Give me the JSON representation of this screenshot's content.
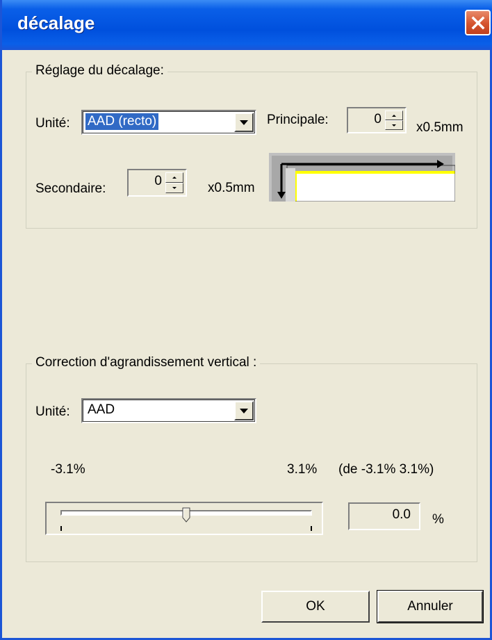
{
  "window": {
    "title": "décalage"
  },
  "offset_group": {
    "label": "Réglage du décalage:",
    "unit_label": "Unité:",
    "unit_value": "AAD (recto)",
    "main_label": "Principale:",
    "main_value": "0",
    "main_unit": "x0.5mm",
    "secondary_label": "Secondaire:",
    "secondary_value": "0",
    "secondary_unit": "x0.5mm"
  },
  "magnify_group": {
    "label": "Correction d'agrandissement vertical :",
    "unit_label": "Unité:",
    "unit_value": "AAD",
    "min_label": "-3.1%",
    "max_label": "3.1%",
    "range_label": "(de -3.1%  3.1%)",
    "slider": {
      "min": -3.1,
      "max": 3.1,
      "value": 0.0
    },
    "value": "0.0",
    "value_unit": "%"
  },
  "buttons": {
    "ok": "OK",
    "cancel": "Annuler"
  },
  "icons": {
    "close": "close-icon",
    "preview": "offset-preview-icon"
  },
  "colors": {
    "titlebar": "#0050dd",
    "close": "#d5542e",
    "selection": "#316ac5"
  }
}
